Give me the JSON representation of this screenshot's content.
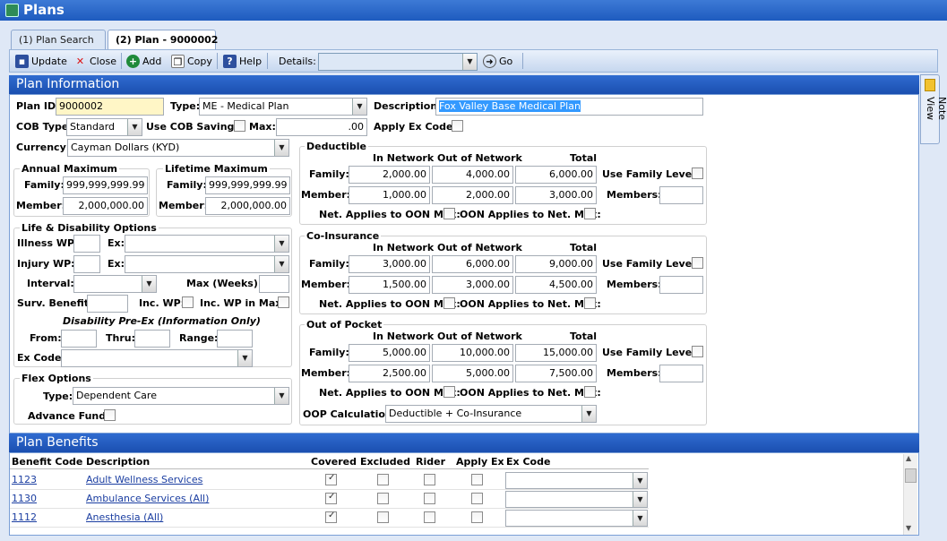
{
  "window": {
    "title": "Plans"
  },
  "tabs": [
    {
      "label": "(1) Plan Search"
    },
    {
      "label": "(2) Plan - 9000002"
    }
  ],
  "toolbar": {
    "update": "Update",
    "close": "Close",
    "add": "Add",
    "copy": "Copy",
    "help": "Help",
    "details_label": "Details:",
    "details_value": "",
    "go": "Go"
  },
  "plan_info": {
    "header": "Plan Information",
    "note_view": "Note View",
    "plan_id_label": "Plan ID:",
    "plan_id": "9000002",
    "type_label": "Type:",
    "type": "ME - Medical Plan",
    "description_label": "Description:",
    "description": "Fox Valley Base Medical Plan",
    "cob_type_label": "COB Type:",
    "cob_type": "Standard",
    "use_cob_savings_label": "Use COB Savings:",
    "max_label": "Max:",
    "max": ".00",
    "apply_ex_code_label": "Apply Ex Code:",
    "currency_label": "Currency:",
    "currency": "Cayman Dollars (KYD)"
  },
  "annual_max": {
    "title": "Annual Maximum",
    "family_label": "Family:",
    "family": "999,999,999.99",
    "member_label": "Member:",
    "member": "2,000,000.00"
  },
  "lifetime_max": {
    "title": "Lifetime Maximum",
    "family_label": "Family:",
    "family": "999,999,999.99",
    "member_label": "Member:",
    "member": "2,000,000.00"
  },
  "life": {
    "title": "Life & Disability Options",
    "illness_wp": "Illness WP:",
    "ex": "Ex:",
    "injury_wp": "Injury WP:",
    "interval": "Interval:",
    "max_weeks": "Max (Weeks):",
    "surv_benefit": "Surv. Benefit:",
    "inc_wp": "Inc. WP:",
    "inc_wp_in_max": "Inc. WP in Max:",
    "preex_title": "Disability Pre-Ex (Information Only)",
    "from": "From:",
    "thru": "Thru:",
    "range": "Range:",
    "ex_code": "Ex Code:"
  },
  "flex": {
    "title": "Flex Options",
    "type_label": "Type:",
    "type": "Dependent Care",
    "advance_fund": "Advance Fund:"
  },
  "cols": {
    "in": "In Network",
    "out": "Out of Network",
    "total": "Total"
  },
  "common": {
    "family": "Family:",
    "member": "Member:",
    "use_family_level": "Use Family Level:",
    "members": "Members:",
    "net_applies": "Net. Applies to OON Max:",
    "oon_applies": "OON Applies to Net. Max:"
  },
  "deductible": {
    "title": "Deductible",
    "family": [
      "2,000.00",
      "4,000.00",
      "6,000.00"
    ],
    "member": [
      "1,000.00",
      "2,000.00",
      "3,000.00"
    ]
  },
  "coins": {
    "title": "Co-Insurance",
    "family": [
      "3,000.00",
      "6,000.00",
      "9,000.00"
    ],
    "member": [
      "1,500.00",
      "3,000.00",
      "4,500.00"
    ]
  },
  "oop": {
    "title": "Out of Pocket",
    "family": [
      "5,000.00",
      "10,000.00",
      "15,000.00"
    ],
    "member": [
      "2,500.00",
      "5,000.00",
      "7,500.00"
    ],
    "calc_label": "OOP Calculation:",
    "calc": "Deductible + Co-Insurance"
  },
  "benefits": {
    "header": "Plan Benefits",
    "columns": [
      "Benefit Code",
      "Description",
      "Covered",
      "Excluded",
      "Rider",
      "Apply Ex",
      "Ex Code"
    ],
    "rows": [
      {
        "code": "1123",
        "desc": "Adult Wellness Services",
        "covered": true
      },
      {
        "code": "1130",
        "desc": "Ambulance Services (All)",
        "covered": true
      },
      {
        "code": "1112",
        "desc": "Anesthesia (All)",
        "covered": true
      }
    ]
  }
}
